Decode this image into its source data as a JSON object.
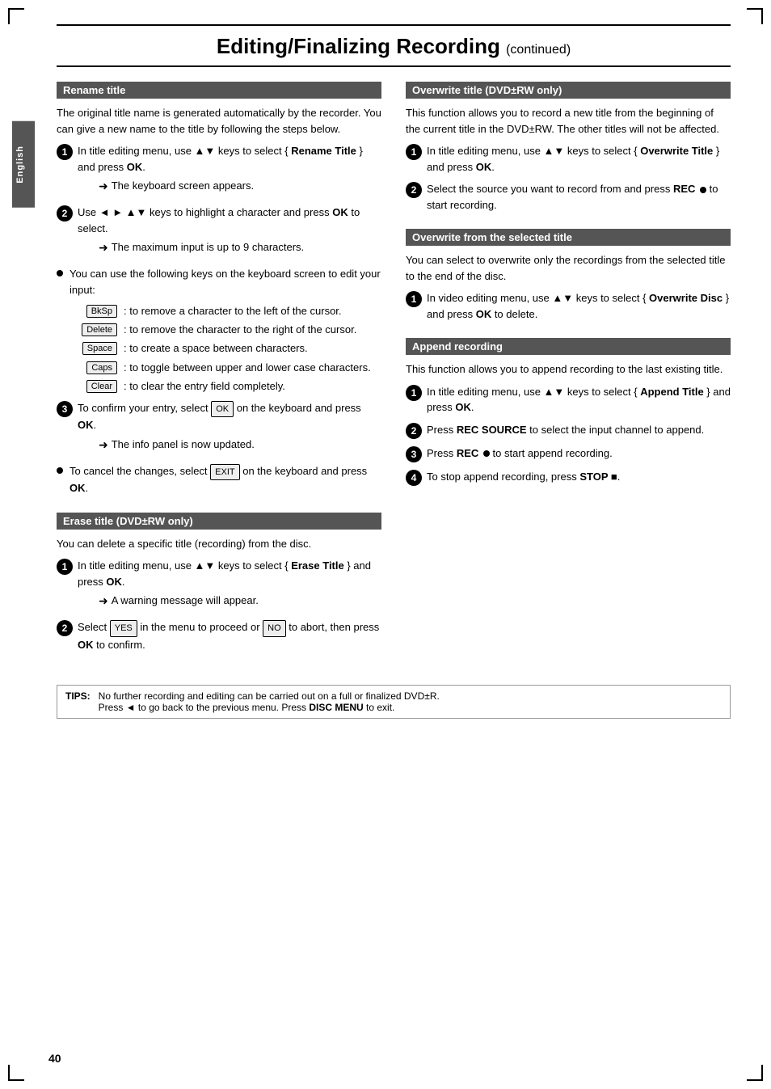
{
  "page": {
    "title": "Editing/Finalizing Recording",
    "continued": "(continued)",
    "page_number": "40",
    "sidebar_label": "English"
  },
  "left": {
    "rename_title": {
      "header": "Rename title",
      "intro": "The original title name is generated automatically by the recorder. You can give a new name to the title by following the steps below.",
      "step1_text": "In title editing menu, use ▲▼ keys to select { Rename Title } and press OK.",
      "step1_bold_parts": [
        "Rename Title",
        "OK"
      ],
      "step1_arrow": "The keyboard screen appears.",
      "step2_text": "Use ◄ ► ▲▼ keys to highlight a character and press OK to select.",
      "step2_bold_parts": [
        "OK"
      ],
      "step2_arrow": "The maximum input is up to 9 characters.",
      "bullet1_text": "You can use the following keys on the keyboard screen to edit your input:",
      "keys": [
        {
          "key": "BkSp",
          "desc": ": to remove a character to the left of the cursor."
        },
        {
          "key": "Delete",
          "desc": ": to remove the character to the right of the cursor."
        },
        {
          "key": "Space",
          "desc": ": to create a space between characters."
        },
        {
          "key": "Caps",
          "desc": ": to toggle between upper and lower case characters."
        },
        {
          "key": "Clear",
          "desc": ": to clear the entry field completely."
        }
      ],
      "step3_pre": "To confirm your entry, select",
      "step3_key": "OK",
      "step3_post": "on the keyboard and press OK.",
      "step3_arrow": "The info panel is now updated.",
      "bullet2_pre": "To cancel the changes, select",
      "bullet2_key": "EXIT",
      "bullet2_post": "on the keyboard and press OK."
    },
    "erase_title": {
      "header": "Erase title (DVD±RW only)",
      "intro": "You can delete a specific title (recording) from the disc.",
      "step1_text": "In title editing menu, use ▲▼ keys to select { Erase Title } and press OK.",
      "step1_bold_parts": [
        "Erase Title",
        "OK"
      ],
      "step1_arrow": "A warning message will appear.",
      "step2_pre": "Select",
      "step2_key1": "YES",
      "step2_mid": "in the menu to proceed or",
      "step2_key2": "NO",
      "step2_post": "to abort, then press OK to confirm.",
      "step2_bold": [
        "OK"
      ]
    }
  },
  "right": {
    "overwrite_title": {
      "header": "Overwrite title (DVD±RW only)",
      "intro": "This function allows you to record a new title from the beginning of the current title in the DVD±RW. The other titles will not be affected.",
      "step1_text": "In title editing menu, use ▲▼ keys to select { Overwrite Title } and press OK.",
      "step1_bold_parts": [
        "Overwrite Title",
        "OK"
      ],
      "step2_text": "Select the source you want to record from and press REC",
      "step2_bold": [
        "REC"
      ],
      "step2_post": "to start recording."
    },
    "overwrite_selected": {
      "header": "Overwrite from the selected title",
      "intro": "You can select to overwrite only the recordings from the selected title to the end of the disc.",
      "step1_text": "In video editing menu, use ▲▼ keys to select { Overwrite Disc } and press OK to delete.",
      "step1_bold_parts": [
        "Overwrite Disc",
        "OK"
      ]
    },
    "append_recording": {
      "header": "Append recording",
      "intro": "This function allows you to append recording to the last existing title.",
      "step1_text": "In title editing menu, use ▲▼ keys to select { Append Title } and press OK.",
      "step1_bold_parts": [
        "Append Title",
        "OK"
      ],
      "step2_text": "Press REC SOURCE to select the input channel to append.",
      "step2_bold": [
        "REC SOURCE"
      ],
      "step3_text": "Press REC",
      "step3_bold": [
        "REC"
      ],
      "step3_post": "to start append recording.",
      "step4_text": "To stop append recording, press STOP",
      "step4_bold": [
        "STOP"
      ]
    }
  },
  "tips": {
    "label": "TIPS:",
    "text": "No further recording and editing can be carried out on a full or finalized DVD±R.",
    "text2": "Press ◄ to go back to the previous menu. Press DISC MENU to exit.",
    "disc_menu_bold": [
      "DISC MENU"
    ]
  }
}
